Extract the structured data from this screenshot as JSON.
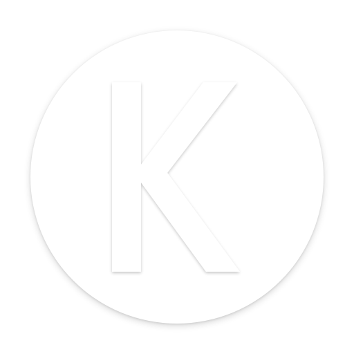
{
  "logo": {
    "letter": "K",
    "badge_color": "#ffffff",
    "letter_color": "#ffffff",
    "background_color": "#ffffff"
  }
}
